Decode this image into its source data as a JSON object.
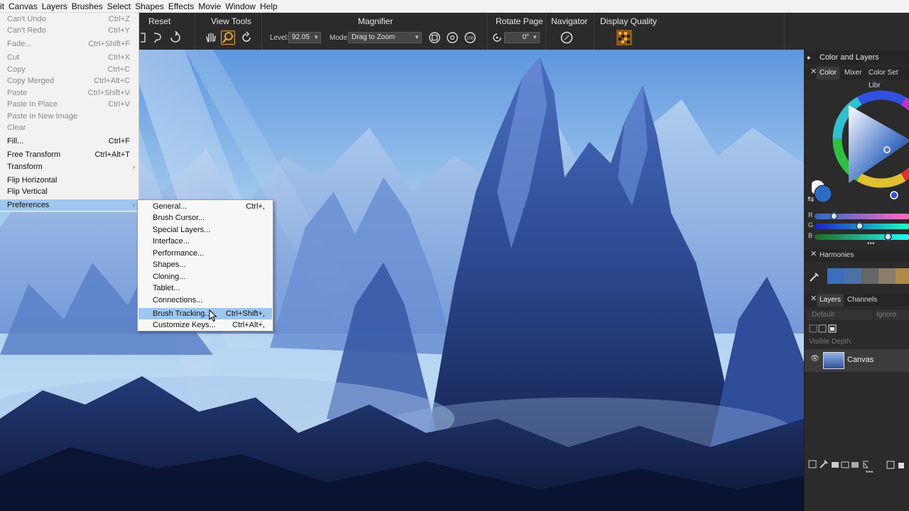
{
  "menubar": {
    "items": [
      "it",
      "Canvas",
      "Layers",
      "Brushes",
      "Select",
      "Shapes",
      "Effects",
      "Movie",
      "Window",
      "Help"
    ]
  },
  "edit_menu": {
    "items": [
      {
        "label": "Can't Undo",
        "shortcut": "Ctrl+Z",
        "disabled": true
      },
      {
        "label": "Can't Redo",
        "shortcut": "Ctrl+Y",
        "disabled": true
      },
      {
        "label": "Fade...",
        "shortcut": "Ctrl+Shift+F",
        "disabled": true
      },
      {
        "label": "Cut",
        "shortcut": "Ctrl+X",
        "disabled": true
      },
      {
        "label": "Copy",
        "shortcut": "Ctrl+C",
        "disabled": true
      },
      {
        "label": "Copy Merged",
        "shortcut": "Ctrl+Alt+C",
        "disabled": true
      },
      {
        "label": "Paste",
        "shortcut": "Ctrl+Shift+V",
        "disabled": true
      },
      {
        "label": "Paste In Place",
        "shortcut": "Ctrl+V",
        "disabled": true
      },
      {
        "label": "Paste In New Image",
        "shortcut": "",
        "disabled": true
      },
      {
        "label": "Clear",
        "shortcut": "",
        "disabled": true
      },
      {
        "label": "Fill...",
        "shortcut": "Ctrl+F",
        "disabled": false
      },
      {
        "label": "Free Transform",
        "shortcut": "Ctrl+Alt+T",
        "disabled": false
      },
      {
        "label": "Transform",
        "shortcut": "",
        "disabled": false,
        "submenu": true
      },
      {
        "label": "Flip Horizontal",
        "shortcut": "",
        "disabled": false
      },
      {
        "label": "Flip Vertical",
        "shortcut": "",
        "disabled": false
      },
      {
        "label": "Preferences",
        "shortcut": "",
        "disabled": false,
        "submenu": true,
        "highlighted": true
      }
    ]
  },
  "preferences_menu": {
    "items": [
      {
        "label": "General...",
        "shortcut": "Ctrl+,"
      },
      {
        "label": "Brush Cursor...",
        "shortcut": ""
      },
      {
        "label": "Special Layers...",
        "shortcut": ""
      },
      {
        "label": "Interface...",
        "shortcut": ""
      },
      {
        "label": "Performance...",
        "shortcut": ""
      },
      {
        "label": "Shapes...",
        "shortcut": ""
      },
      {
        "label": "Cloning...",
        "shortcut": ""
      },
      {
        "label": "Tablet...",
        "shortcut": ""
      },
      {
        "label": "Connections...",
        "shortcut": ""
      },
      {
        "label": "Brush Tracking...",
        "shortcut": "Ctrl+Shift+,",
        "highlighted": true
      },
      {
        "label": "Customize Keys...",
        "shortcut": "Ctrl+Alt+,"
      }
    ]
  },
  "toolbar": {
    "reset": "Reset",
    "view_tools": "View Tools",
    "magnifier": "Magnifier",
    "level_label": "Level:",
    "level_value": "92.05",
    "mode_label": "Mode:",
    "mode_value": "Drag to Zoom",
    "rotate_page": "Rotate Page",
    "rotate_value": "0°",
    "navigator": "Navigator",
    "display_quality": "Display Quality"
  },
  "panel": {
    "color_and_layers": "Color and Layers",
    "color_tabs": [
      "Color",
      "Mixer",
      "Color Set Libr"
    ],
    "rgb": {
      "r_label": "R",
      "g_label": "G",
      "b_label": "B",
      "r": 0.2,
      "g": 0.47,
      "b": 0.77
    },
    "harmonies": "Harmonies",
    "harmony_colors": [
      "#3b6fbd",
      "#4a72a6",
      "#666666",
      "#8a7e6a",
      "#b08a4a",
      "#d9902e"
    ],
    "layers_tabs": [
      "Layers",
      "Channels"
    ],
    "composite_method": "Default",
    "composite_depth": "Ignore",
    "visible_depth": "Visible Depth:",
    "layer_name": "Canvas"
  },
  "colors": {
    "menu_highlight": "#9fc6ef",
    "accent": "#e8a13a",
    "panel_bg": "#2b2b2b"
  }
}
